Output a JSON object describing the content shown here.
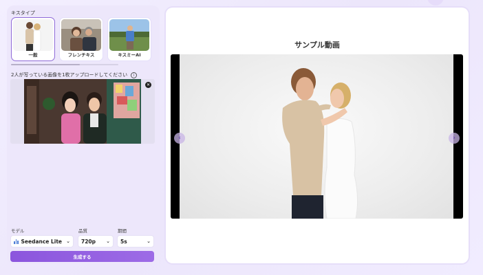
{
  "kiss_types": {
    "label": "キスタイプ",
    "items": [
      {
        "label": "一般",
        "selected": true
      },
      {
        "label": "フレンチキス",
        "selected": false
      },
      {
        "label": "キスミーAI",
        "selected": false
      }
    ]
  },
  "upload": {
    "label": "2人が写っている画像を1枚アップロードしてください",
    "info_icon": "info-icon",
    "close_icon": "close-icon"
  },
  "settings": {
    "model": {
      "label": "モデル",
      "value": "Seedance Lite"
    },
    "quality": {
      "label": "品質",
      "value": "720p"
    },
    "duration": {
      "label": "期間",
      "value": "5s"
    }
  },
  "generate_button": "生成する",
  "preview": {
    "title": "サンプル動画"
  },
  "colors": {
    "accent": "#8f6ad8",
    "button": "#9360e0"
  }
}
